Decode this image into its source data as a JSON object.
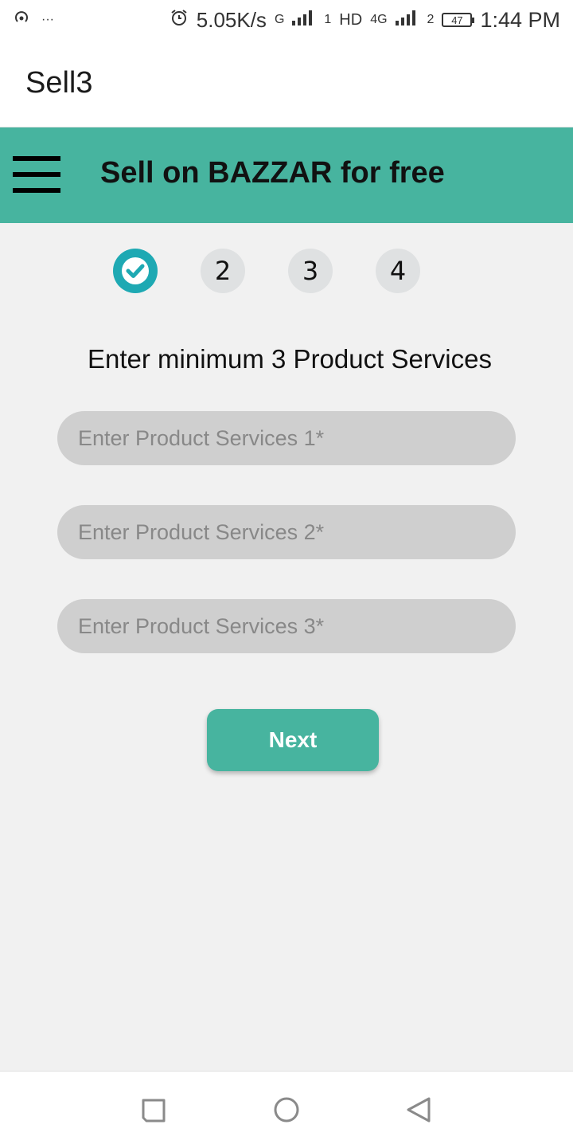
{
  "status_bar": {
    "net_speed": "5.05K/s",
    "sim1_label": "G",
    "sim1_index": "1",
    "hd_label": "HD",
    "network_label": "4G",
    "sim2_index": "2",
    "battery": "47",
    "time": "1:44 PM",
    "more": "···"
  },
  "app_bar": {
    "title": "Sell3"
  },
  "header": {
    "title": "Sell on BAZZAR for free",
    "menu_icon": "hamburger-icon",
    "color": "#47b49f"
  },
  "steps": {
    "current": 2,
    "items": [
      {
        "label": "",
        "completed": true,
        "icon": "check-icon"
      },
      {
        "label": "2",
        "completed": false
      },
      {
        "label": "3",
        "completed": false
      },
      {
        "label": "4",
        "completed": false
      }
    ],
    "completed_color": "#1ea9b3"
  },
  "form": {
    "instruction": "Enter minimum 3 Product Services",
    "fields": [
      {
        "placeholder": "Enter Product Services 1*",
        "value": ""
      },
      {
        "placeholder": "Enter Product Services 2*",
        "value": ""
      },
      {
        "placeholder": "Enter Product Services 3*",
        "value": ""
      }
    ],
    "next_label": "Next"
  },
  "nav_bar": {
    "recent_icon": "recent-apps-icon",
    "home_icon": "home-icon",
    "back_icon": "back-icon"
  }
}
